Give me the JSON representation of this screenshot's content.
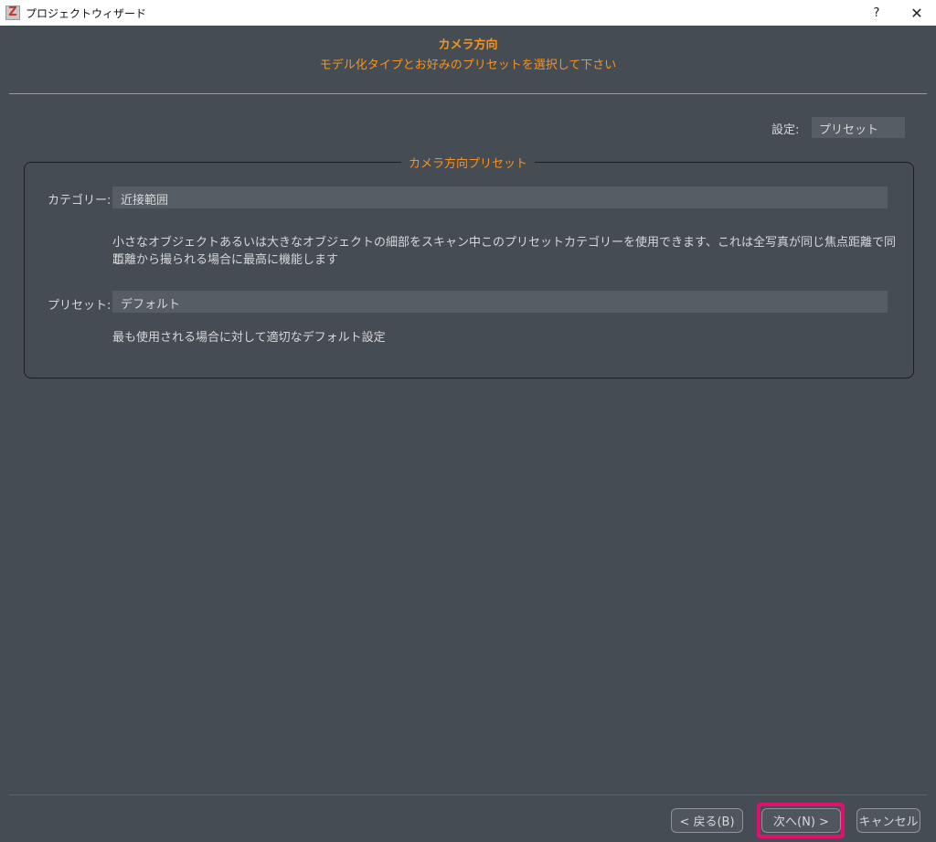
{
  "window": {
    "icon_letter": "Z",
    "title": "プロジェクトウィザード",
    "help_label": "?",
    "close_label": "✕"
  },
  "header": {
    "title": "カメラ方向",
    "subtitle": "モデル化タイプとお好みのプリセットを選択して下さい"
  },
  "settings": {
    "label": "設定:",
    "value": "プリセット"
  },
  "group": {
    "legend": "カメラ方向プリセット",
    "category_label": "カテゴリー:",
    "category_value": "近接範囲",
    "category_description_line1": "小さなオブジェクトあるいは大きなオブジェクトの細部をスキャン中このプリセットカテゴリーを使用できます、これは全写真が同じ焦点距離で同じ",
    "category_description_line2": "距離から撮られる場合に最高に機能します",
    "preset_label": "プリセット:",
    "preset_value": "デフォルト",
    "preset_description": "最も使用される場合に対して適切なデフォルト設定"
  },
  "footer": {
    "back_label": "< 戻る(B)",
    "next_label": "次へ(N) >",
    "cancel_label": "キャンセル"
  },
  "colors": {
    "accent": "#f7941d",
    "background": "#464c53",
    "highlight": "#e0106e"
  }
}
